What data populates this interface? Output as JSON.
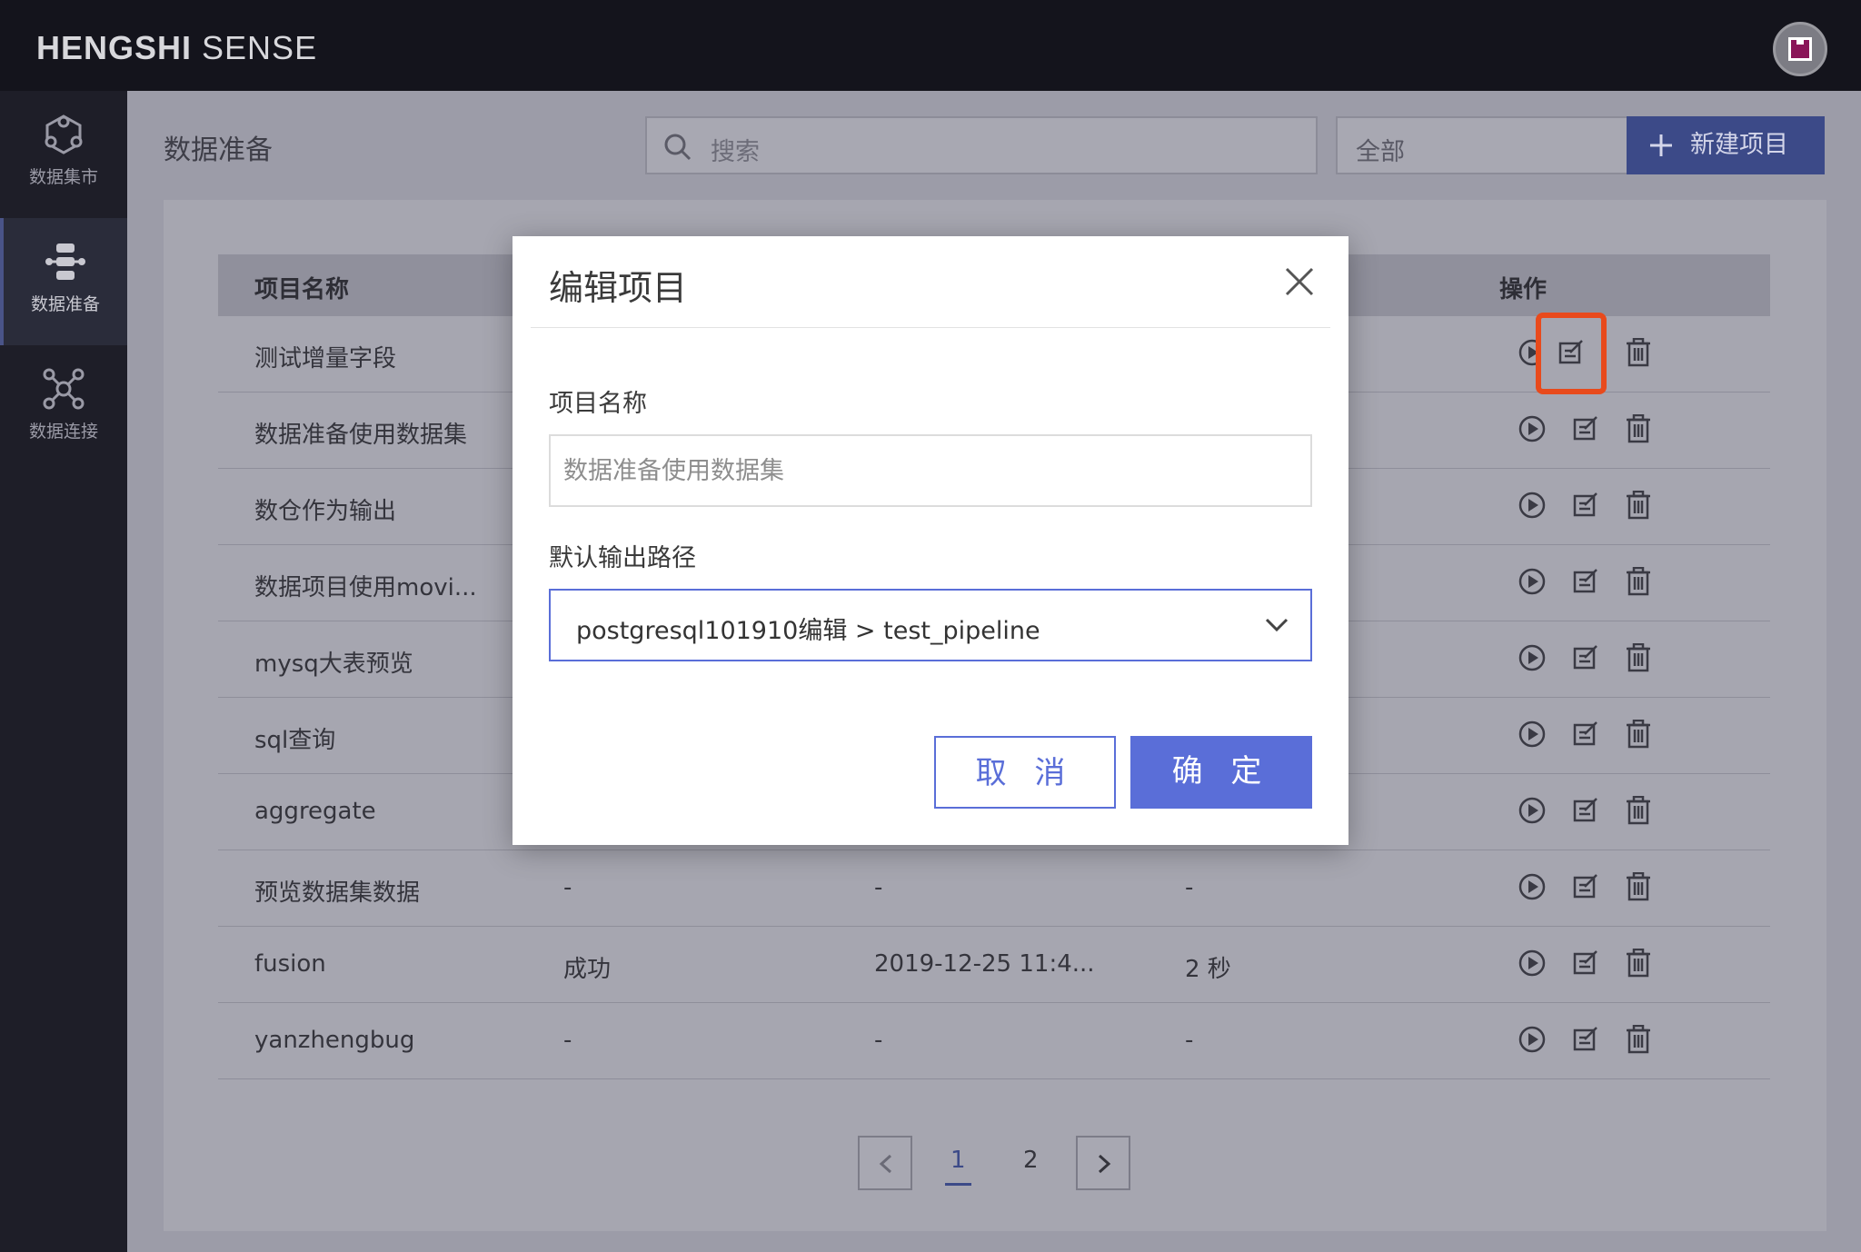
{
  "brand": {
    "bold": "HENGSHI",
    "light": " SENSE"
  },
  "sidebar": {
    "items": [
      {
        "label": "数据集市",
        "icon": "data-mart-icon"
      },
      {
        "label": "数据准备",
        "icon": "data-prep-icon",
        "active": true
      },
      {
        "label": "数据连接",
        "icon": "data-connect-icon"
      }
    ]
  },
  "header": {
    "title": "数据准备",
    "search_placeholder": "搜索",
    "filter_value": "全部",
    "new_button": "新建项目"
  },
  "table": {
    "columns": [
      "项目名称",
      "",
      "",
      "",
      "操作"
    ],
    "rows": [
      {
        "name": "测试增量字段",
        "status": "",
        "time": "",
        "duration": ""
      },
      {
        "name": "数据准备使用数据集",
        "status": "",
        "time": "",
        "duration": ""
      },
      {
        "name": "数仓作为输出",
        "status": "",
        "time": "",
        "duration": ""
      },
      {
        "name": "数据项目使用movi...",
        "status": "",
        "time": "",
        "duration": ""
      },
      {
        "name": "mysq大表预览",
        "status": "",
        "time": "",
        "duration": ""
      },
      {
        "name": "sql查询",
        "status": "",
        "time": "",
        "duration": ""
      },
      {
        "name": "aggregate",
        "status": "",
        "time": "",
        "duration": ""
      },
      {
        "name": "预览数据集数据",
        "status": "-",
        "time": "-",
        "duration": "-"
      },
      {
        "name": "fusion",
        "status": "成功",
        "time": "2019-12-25 11:4...",
        "duration": "2 秒"
      },
      {
        "name": "yanzhengbug",
        "status": "-",
        "time": "-",
        "duration": "-"
      }
    ]
  },
  "pagination": {
    "pages": [
      "1",
      "2"
    ],
    "current": "1"
  },
  "modal": {
    "title": "编辑项目",
    "name_label": "项目名称",
    "name_placeholder": "数据准备使用数据集",
    "path_label": "默认输出路径",
    "path_value": "postgresql101910编辑 > test_pipeline",
    "cancel": "取 消",
    "ok": "确 定"
  },
  "colors": {
    "accent": "#5a6ed8",
    "highlight": "#e84a1c",
    "topbar": "#14141c"
  }
}
